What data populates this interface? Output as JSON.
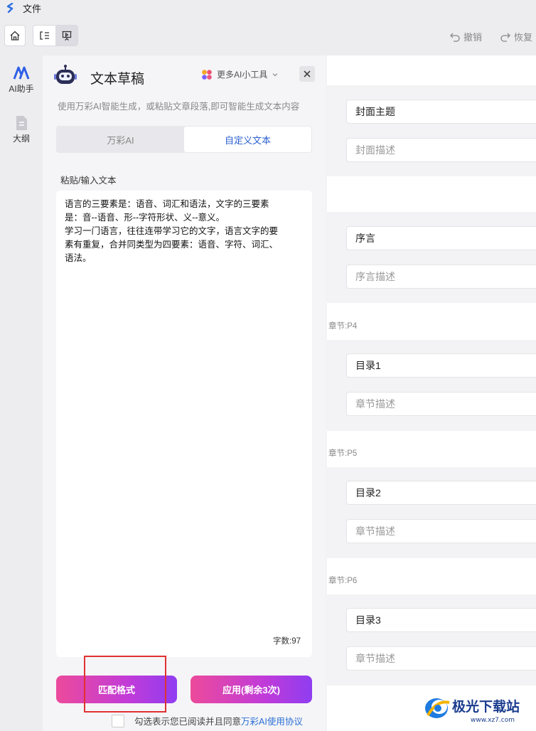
{
  "window": {
    "title": "文件"
  },
  "toolbar": {
    "undo_label": "撤销",
    "redo_label": "恢复"
  },
  "rail": {
    "ai_label": "AI助手",
    "outline_label": "大纲"
  },
  "panel": {
    "title": "文本草稿",
    "more_tools": "更多AI小工具",
    "subtitle": "使用万彩AI智能生成，或粘贴文章段落,即可智能生成文本内容",
    "tabs": [
      {
        "label": "万彩AI"
      },
      {
        "label": "自定义文本"
      }
    ],
    "active_tab": "自定义文本",
    "input_label": "粘贴/输入文本",
    "text_lines": [
      "语言的三要素是：语音、词汇和语法，文字的三要素",
      "是：音--语音、形--字符形状、义--意义。",
      "学习一门语言，往往连带学习它的文字，语言文字的要",
      "素有重复，合并同类型为四要素：语音、字符、词汇、",
      "语法。"
    ],
    "word_count": "字数:97",
    "match_button": "匹配格式",
    "apply_button": "应用(剩余3次)",
    "agree_text": "勾选表示您已阅读并且同意",
    "agree_link": "万彩AI使用协议"
  },
  "outline": {
    "cover_title": "封面主题",
    "cover_desc": "封面描述",
    "preface": "序言",
    "preface_desc": "序言描述",
    "sections": [
      {
        "label": "章节:P4",
        "title": "目录1",
        "desc": "章节描述"
      },
      {
        "label": "章节:P5",
        "title": "目录2",
        "desc": "章节描述"
      },
      {
        "label": "章节:P6",
        "title": "目录3",
        "desc": "章节描述"
      }
    ]
  },
  "watermark": {
    "text": "极光下载站",
    "url": "www.xz7.com"
  },
  "colors": {
    "accent_blue": "#2a5fcf",
    "gradient_start": "#ec4a9b",
    "gradient_end": "#8f3df1",
    "highlight_red": "#e03131"
  }
}
